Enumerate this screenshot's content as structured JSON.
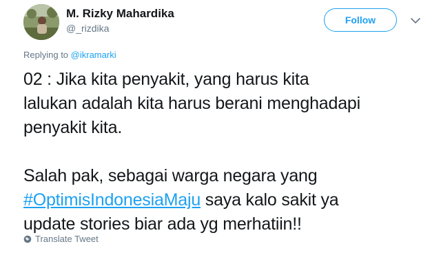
{
  "author": {
    "name": "M. Rizky Mahardika",
    "handle": "@_rizdika",
    "avatar_icon": "avatar-photo"
  },
  "actions": {
    "follow_label": "Follow",
    "more_icon": "chevron-down-icon"
  },
  "reply": {
    "prefix": "Replying to ",
    "mention": "@ikramarki"
  },
  "body": {
    "line1": "02 : Jika kita penyakit, yang harus kita",
    "line2": "lalukan adalah kita harus berani menghadapi",
    "line3": "penyakit kita.",
    "line4": "Salah pak, sebagai warga negara yang",
    "hashtag": "#OptimisIndonesiaMaju",
    "line5_rest": " saya kalo sakit ya",
    "line6": "update stories biar ada yg merhatiin!!"
  },
  "translate": {
    "label": "Translate Tweet",
    "icon": "globe-icon"
  },
  "colors": {
    "accent": "#1da1f2",
    "text": "#14171a",
    "muted": "#657786"
  }
}
